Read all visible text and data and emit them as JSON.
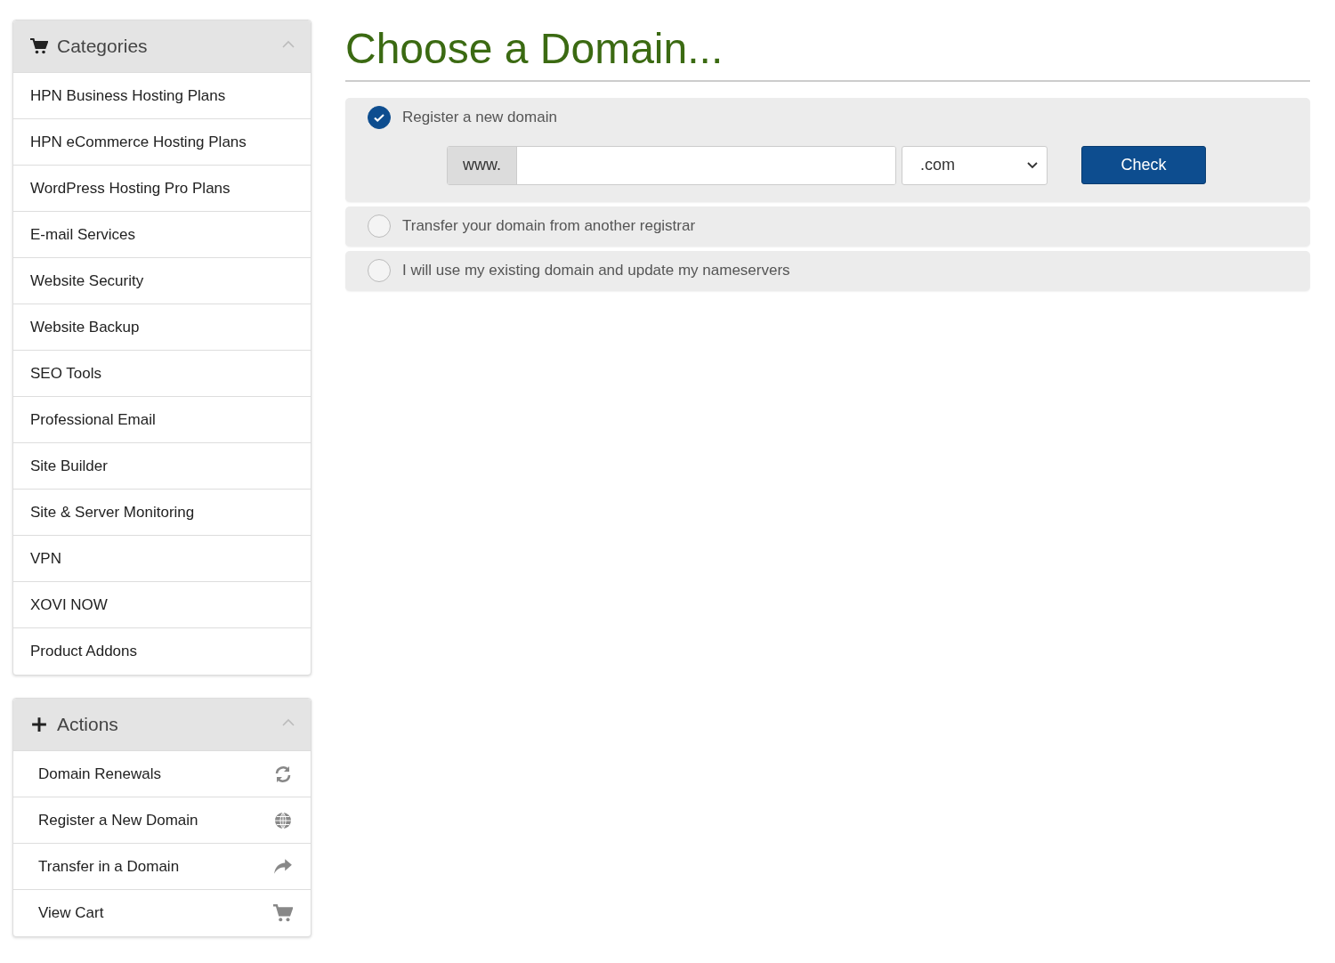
{
  "sidebar": {
    "panels": [
      {
        "kind": "cart",
        "title": "Categories",
        "expanded": true,
        "items": [
          {
            "label": "HPN Business Hosting Plans"
          },
          {
            "label": "HPN eCommerce Hosting Plans"
          },
          {
            "label": "WordPress Hosting Pro Plans"
          },
          {
            "label": "E-mail Services"
          },
          {
            "label": "Website Security"
          },
          {
            "label": "Website Backup"
          },
          {
            "label": "SEO Tools"
          },
          {
            "label": "Professional Email"
          },
          {
            "label": "Site Builder"
          },
          {
            "label": "Site & Server Monitoring"
          },
          {
            "label": "VPN"
          },
          {
            "label": "XOVI NOW"
          },
          {
            "label": "Product Addons"
          }
        ]
      },
      {
        "kind": "plus",
        "title": "Actions",
        "expanded": true,
        "items": [
          {
            "label": "Domain Renewals",
            "kind": "refresh"
          },
          {
            "label": "Register a New Domain",
            "kind": "globe"
          },
          {
            "label": "Transfer in a Domain",
            "kind": "share"
          },
          {
            "label": "View Cart",
            "kind": "cart"
          }
        ]
      }
    ]
  },
  "main": {
    "title": "Choose a Domain...",
    "options": [
      {
        "label": "Register a new domain",
        "selected": true,
        "domain_form": {
          "prefix": "www.",
          "tld": ".com",
          "button": "Check"
        }
      },
      {
        "label": "Transfer your domain from another registrar",
        "selected": false
      },
      {
        "label": "I will use my existing domain and update my nameservers",
        "selected": false
      }
    ]
  }
}
